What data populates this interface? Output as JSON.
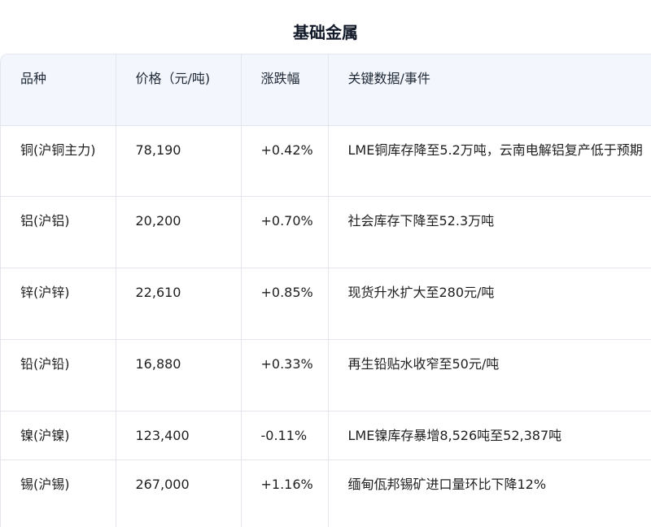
{
  "title": "基础金属",
  "headers": {
    "variety": "品种",
    "price": "价格（元/吨)",
    "change": "涨跌幅",
    "events": "关键数据/事件"
  },
  "rows": [
    {
      "variety": "铜(沪铜主力)",
      "price": "78,190",
      "change": "+0.42%",
      "events": "LME铜库存降至5.2万吨，云南电解铝复产低于预期"
    },
    {
      "variety": "铝(沪铝)",
      "price": "20,200",
      "change": "+0.70%",
      "events": "社会库存下降至52.3万吨"
    },
    {
      "variety": "锌(沪锌)",
      "price": "22,610",
      "change": "+0.85%",
      "events": "现货升水扩大至280元/吨"
    },
    {
      "variety": "铅(沪铅)",
      "price": "16,880",
      "change": "+0.33%",
      "events": "再生铅贴水收窄至50元/吨"
    },
    {
      "variety": "镍(沪镍)",
      "price": "123,400",
      "change": "-0.11%",
      "events": "LME镍库存暴增8,526吨至52,387吨"
    },
    {
      "variety": "锡(沪锡)",
      "price": "267,000",
      "change": "+1.16%",
      "events": "缅甸佤邦锡矿进口量环比下降12%"
    }
  ]
}
